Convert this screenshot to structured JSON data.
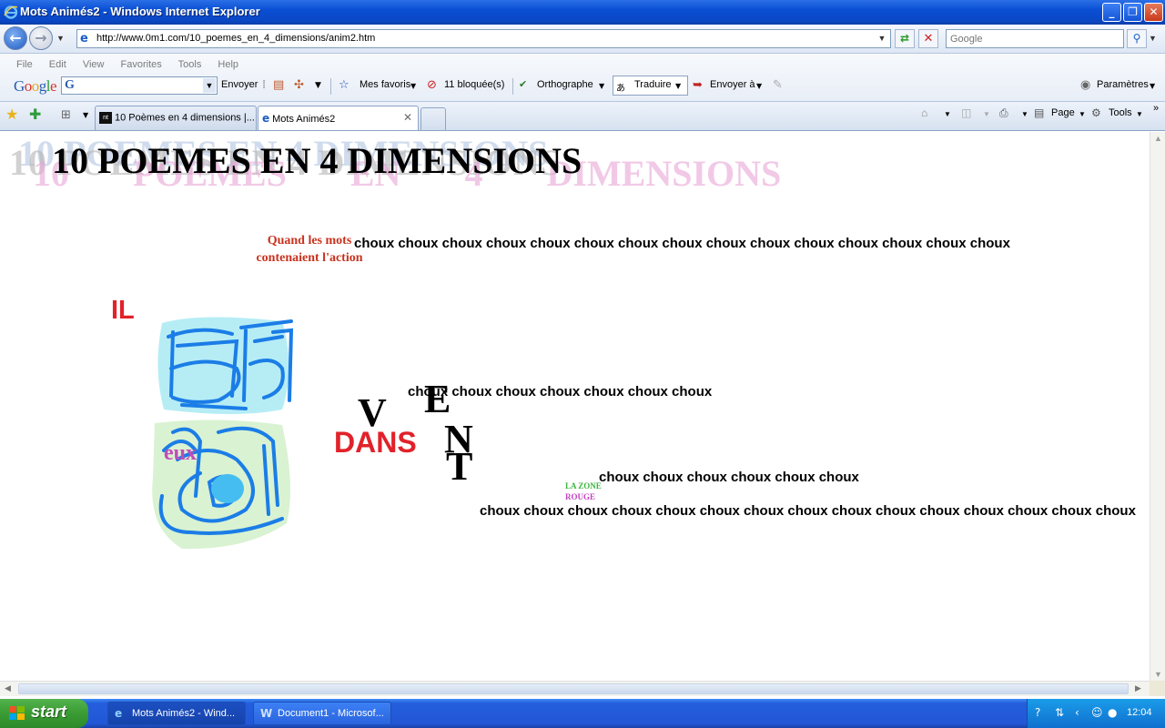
{
  "window": {
    "title": "Mots Animés2 - Windows Internet Explorer"
  },
  "nav": {
    "url": "http://www.0m1.com/10_poemes_en_4_dimensions/anim2.htm",
    "search_placeholder": "Google"
  },
  "menu": [
    "File",
    "Edit",
    "View",
    "Favorites",
    "Tools",
    "Help"
  ],
  "google_toolbar": {
    "logo": "Google",
    "envoyer": "Envoyer",
    "mes_favoris": "Mes favoris",
    "bloquees": "11 bloquée(s)",
    "orthographe": "Orthographe",
    "traduire": "Traduire",
    "envoyer_a": "Envoyer à",
    "parametres": "Paramètres"
  },
  "tabs": [
    {
      "label": "10 Poèmes en 4 dimensions |..."
    },
    {
      "label": "Mots Animés2"
    }
  ],
  "commandbar": {
    "page": "Page",
    "tools": "Tools"
  },
  "page": {
    "headline": "10 POEMES EN 4 DIMENSIONS",
    "intro": "Quand les mots contenaient l'action",
    "word_repeated": "choux",
    "line1": "choux choux choux choux choux choux choux choux choux choux choux choux choux choux choux",
    "line2": "choux choux choux choux choux choux choux",
    "line3": "choux choux choux choux choux choux",
    "line4": "choux choux choux choux choux choux choux choux choux choux choux choux choux choux choux",
    "il": "IL",
    "dans": "DANS",
    "eux": "eux",
    "letter_v": "V",
    "letter_e": "E",
    "letter_n": "N",
    "letter_t": "T",
    "zone_line1": "LA ZONE",
    "zone_line2": "ROUGE"
  },
  "taskbar": {
    "start": "start",
    "tasks": [
      {
        "label": "Mots Animés2 - Wind..."
      },
      {
        "label": "Document1 - Microsof..."
      }
    ],
    "clock": "12:04"
  }
}
